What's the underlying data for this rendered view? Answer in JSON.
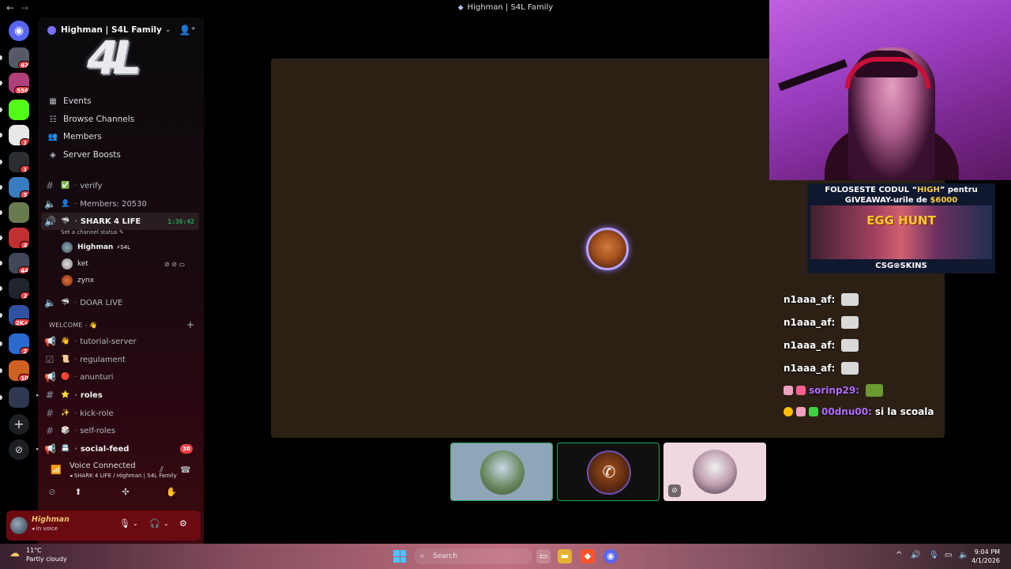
{
  "window": {
    "title": "Highman | S4L Family",
    "back_glyph": "←",
    "forward_glyph": "→"
  },
  "rail": {
    "servers": [
      {
        "name": "discord-home-icon",
        "badge": "",
        "color": "#5865f2"
      },
      {
        "name": "server-s4l",
        "badge": "42",
        "color": "#555a66"
      },
      {
        "name": "server-pink",
        "badge": "556",
        "color": "#b0407a"
      },
      {
        "name": "server-kick",
        "badge": "",
        "color": "#53fc18"
      },
      {
        "name": "server-ring",
        "badge": "1",
        "color": "#e8e8e8"
      },
      {
        "name": "server-csg",
        "badge": "1",
        "color": "#2b2d31"
      },
      {
        "name": "server-blue-cube",
        "badge": "5",
        "color": "#3a7cc0"
      },
      {
        "name": "server-landscape",
        "badge": "",
        "color": "#6a7a50"
      },
      {
        "name": "server-red-horn",
        "badge": "4",
        "color": "#c03030"
      },
      {
        "name": "server-group",
        "badge": "44",
        "color": "#404858"
      },
      {
        "name": "server-w",
        "badge": "2",
        "color": "#20242c"
      },
      {
        "name": "server-mixed",
        "badge": "2K+",
        "color": "#3050a0"
      },
      {
        "name": "server-blue-wave",
        "badge": "2",
        "color": "#2a6ad0"
      },
      {
        "name": "server-fire",
        "badge": "10",
        "color": "#d06020"
      },
      {
        "name": "server-f",
        "badge": "",
        "color": "#303850"
      }
    ],
    "add_server_glyph": "+",
    "discover_glyph": "⊘"
  },
  "sidebar": {
    "server_name": "Highman | S4L Family",
    "banner_text": "4L",
    "quick_links": [
      {
        "label": "Events",
        "icon": "▦"
      },
      {
        "label": "Browse Channels",
        "icon": "☷"
      },
      {
        "label": "Members",
        "icon": "👥"
      },
      {
        "label": "Server Boosts",
        "icon": "◈"
      }
    ],
    "channels_top": [
      {
        "label": "verify",
        "emoji": "✅",
        "icon": "#"
      },
      {
        "label": "Members: 20530",
        "emoji": "👤",
        "icon": "🔈"
      }
    ],
    "voice_active": {
      "label": "SHARK 4 LIFE",
      "emoji": "🦈",
      "timer": "1:36:42",
      "status": "Set a channel status ✎"
    },
    "voice_users": [
      {
        "name": "Highman",
        "tag": "⚡S4L",
        "icons": ""
      },
      {
        "name": "ket",
        "tag": "",
        "icons": "⊘ ⊘ ▭"
      },
      {
        "name": "zynx",
        "tag": "",
        "icons": ""
      }
    ],
    "channels_voice": [
      {
        "label": "DOAR LIVE",
        "emoji": "🦈",
        "icon": "🔈"
      }
    ],
    "category": "WELCOME - 👋",
    "category_add": "+",
    "channels_welcome": [
      {
        "label": "tutorial-server",
        "emoji": "👋",
        "icon": "📢",
        "bold": false,
        "badge": ""
      },
      {
        "label": "regulament",
        "emoji": "📜",
        "icon": "☑",
        "bold": false,
        "badge": ""
      },
      {
        "label": "anunturi",
        "emoji": "🔴",
        "icon": "📢",
        "bold": false,
        "badge": ""
      },
      {
        "label": "roles",
        "emoji": "⭐",
        "icon": "#",
        "bold": true,
        "badge": ""
      },
      {
        "label": "kick-role",
        "emoji": "✨",
        "icon": "#",
        "bold": false,
        "badge": ""
      },
      {
        "label": "self-roles",
        "emoji": "🎲",
        "icon": "#",
        "bold": false,
        "badge": ""
      },
      {
        "label": "social-feed",
        "emoji": "📇",
        "icon": "📢",
        "bold": true,
        "badge": "38"
      }
    ]
  },
  "voice_panel": {
    "title": "Voice Connected",
    "subtitle": "SHARK 4 LIFE / Highman | S4L Family",
    "buttons": [
      "⊘",
      "⬆",
      "✣",
      "✋"
    ]
  },
  "user": {
    "name": "Highman",
    "status": "In voice"
  },
  "stream_chat": [
    {
      "user": "n1aaa_af:",
      "text": "",
      "emote": true,
      "color": "#ffffff"
    },
    {
      "user": "n1aaa_af:",
      "text": "",
      "emote": true,
      "color": "#ffffff"
    },
    {
      "user": "n1aaa_af:",
      "text": "",
      "emote": true,
      "color": "#ffffff"
    },
    {
      "user": "n1aaa_af:",
      "text": "",
      "emote": true,
      "color": "#ffffff"
    },
    {
      "user": "sorinp29:",
      "text": "",
      "emote": true,
      "color": "#b06cff"
    },
    {
      "user": "00dnu00:",
      "text": "si la scoala",
      "emote": false,
      "color": "#b06cff"
    }
  ],
  "ad": {
    "line1_a": "FOLOSESTE CODUL “",
    "line1_code": "HIGH",
    "line1_b": "” pentru",
    "line2_a": "GIVEAWAY-urile de ",
    "line2_amount": "$6000",
    "headline": "EGG HUNT",
    "brand": "CSG⊛SKINS"
  },
  "taskbar": {
    "temp": "11°C",
    "weather": "Partly cloudy",
    "search": "Search",
    "time": "9:04 PM",
    "date": "4/1/2026"
  }
}
